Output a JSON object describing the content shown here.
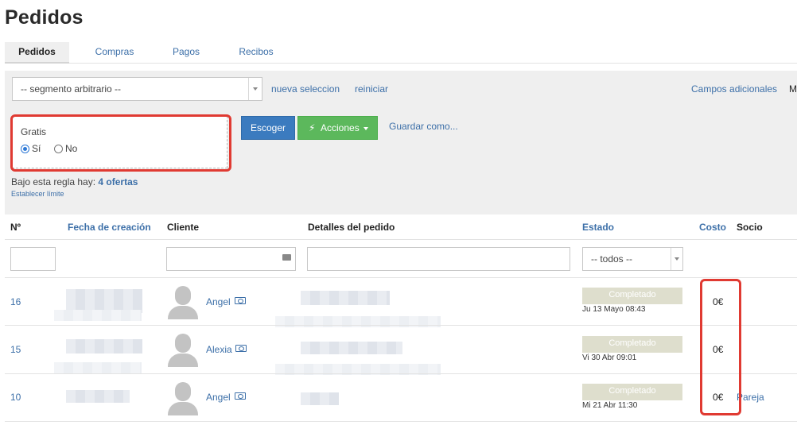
{
  "page": {
    "title": "Pedidos"
  },
  "tabs": [
    {
      "label": "Pedidos",
      "active": true
    },
    {
      "label": "Compras",
      "active": false
    },
    {
      "label": "Pagos",
      "active": false
    },
    {
      "label": "Recibos",
      "active": false
    }
  ],
  "filters": {
    "segment_value": "-- segmento arbitrario --",
    "new_selection_link": "nueva seleccion",
    "reset_link": "reiniciar",
    "additional_fields_link": "Campos adicionales",
    "more_truncated": "M",
    "gratis": {
      "label": "Gratis",
      "options": [
        {
          "label": "Sí",
          "checked": true
        },
        {
          "label": "No",
          "checked": false
        }
      ]
    },
    "choose_button": "Escoger",
    "actions_button": "Acciones",
    "save_as_link": "Guardar como...",
    "rule_text": "Bajo esta regla hay:",
    "rule_count": "4 ofertas",
    "set_limit_link": "Establecer límite"
  },
  "table": {
    "headers": {
      "number": "Nº",
      "created": "Fecha de creación",
      "client": "Cliente",
      "details": "Detalles del pedido",
      "status": "Estado",
      "cost": "Costo",
      "partner": "Socio"
    },
    "status_filter_value": "-- todos --",
    "rows": [
      {
        "number": "16",
        "client": "Angel",
        "status": "Completado",
        "status_date": "Ju 13 Mayo 08:43",
        "cost": "0€",
        "partner": ""
      },
      {
        "number": "15",
        "client": "Alexia",
        "status": "Completado",
        "status_date": "Vi 30 Abr 09:01",
        "cost": "0€",
        "partner": ""
      },
      {
        "number": "10",
        "client": "Angel",
        "status": "Completado",
        "status_date": "Mi 21 Abr 11:30",
        "cost": "0€",
        "partner": "Pareja"
      }
    ]
  },
  "colors": {
    "link": "#3c6fa8",
    "primary_button": "#3b7bbf",
    "success_button": "#5cb85c",
    "highlight": "#e03a32",
    "status_badge": "#dedecd"
  }
}
